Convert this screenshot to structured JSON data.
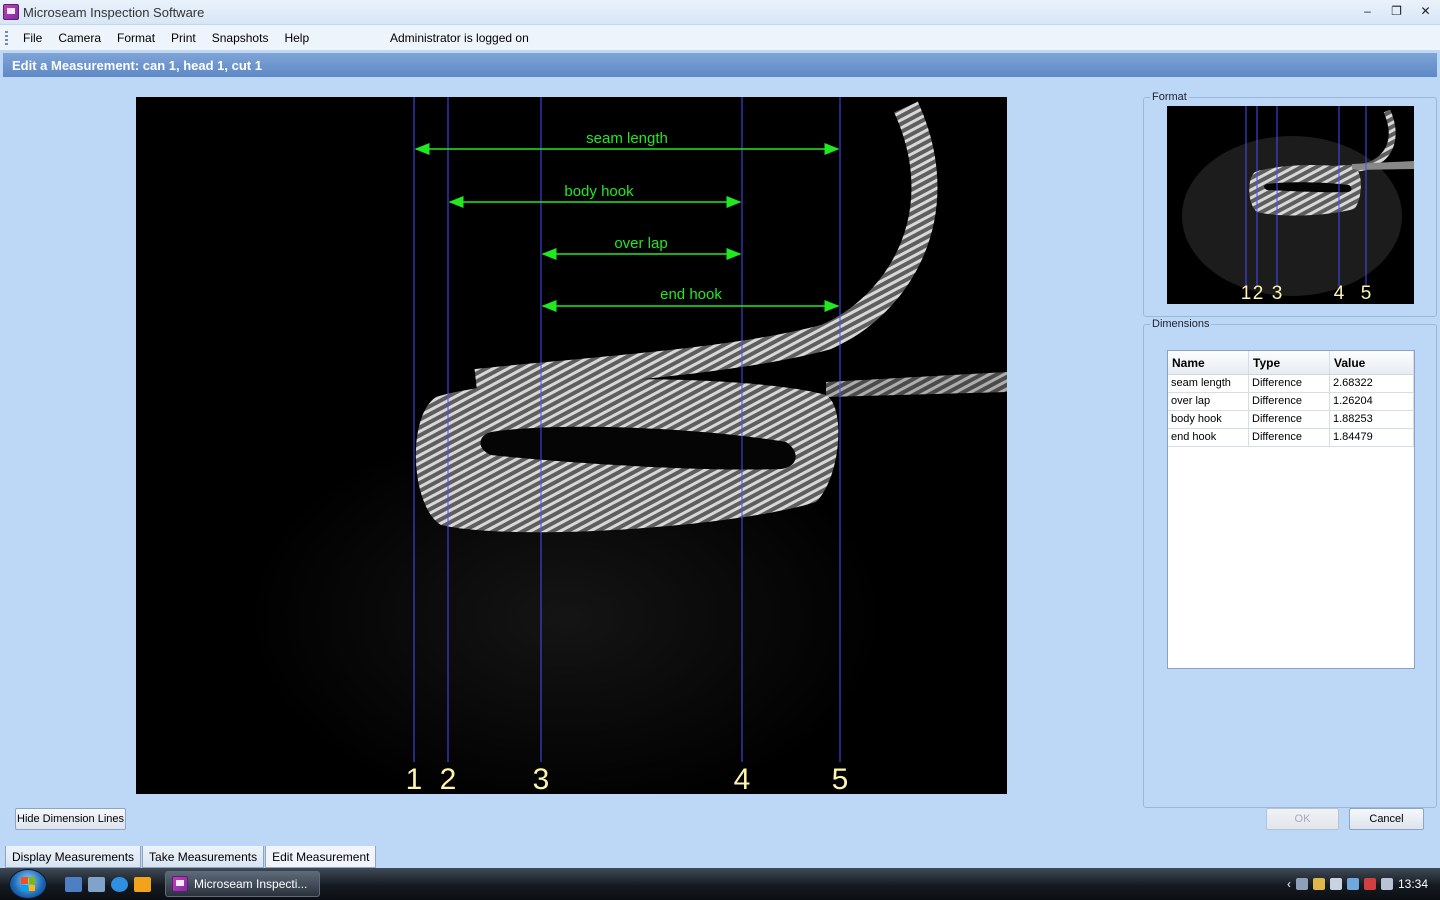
{
  "window": {
    "title": "Microseam Inspection Software",
    "controls": [
      "–",
      "❐",
      "✕"
    ]
  },
  "menu": {
    "items": [
      "File",
      "Camera",
      "Format",
      "Print",
      "Snapshots",
      "Help"
    ],
    "status": "Administrator is logged on"
  },
  "header": {
    "title": "Edit a Measurement: can 1, head 1, cut 1"
  },
  "main_image": {
    "line_numbers": [
      "1",
      "2",
      "3",
      "4",
      "5"
    ],
    "dimension_labels": [
      "seam length",
      "body hook",
      "over lap",
      "end hook"
    ],
    "line_color": "#4a4cff",
    "arrow_color": "#22e822",
    "number_color": "#fff3b0"
  },
  "format_group": {
    "label": "Format",
    "thumbnail_numbers": [
      "1",
      "2",
      "3",
      "4",
      "5"
    ]
  },
  "dimensions_group": {
    "label": "Dimensions",
    "columns": [
      "Name",
      "Type",
      "Value"
    ],
    "rows": [
      {
        "name": "seam length",
        "type": "Difference",
        "value": "2.68322"
      },
      {
        "name": "over lap",
        "type": "Difference",
        "value": "1.26204"
      },
      {
        "name": "body hook",
        "type": "Difference",
        "value": "1.88253"
      },
      {
        "name": "end hook",
        "type": "Difference",
        "value": "1.84479"
      }
    ]
  },
  "buttons": {
    "hide_dimension_lines": "Hide Dimension Lines",
    "ok": "OK",
    "cancel": "Cancel"
  },
  "tabs": [
    "Display Measurements",
    "Take Measurements",
    "Edit Measurement"
  ],
  "taskbar": {
    "active_app": "Microseam Inspecti...",
    "clock": "13:34"
  }
}
